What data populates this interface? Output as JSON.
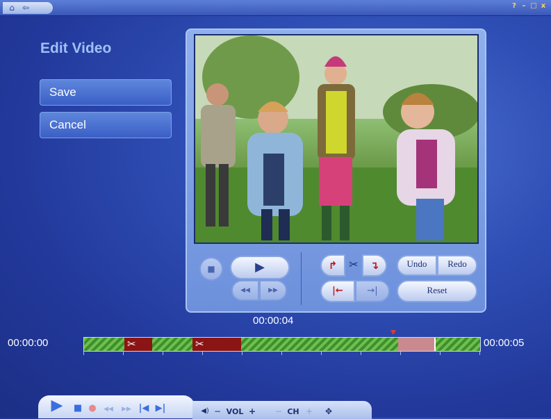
{
  "window": {
    "controls": [
      "?",
      "–",
      "□",
      "x"
    ]
  },
  "nav": {
    "home_icon": "⌂",
    "back_icon": "⇦"
  },
  "page": {
    "title": "Edit Video"
  },
  "actions": {
    "save_label": "Save",
    "cancel_label": "Cancel"
  },
  "editor": {
    "stop_icon": "■",
    "play_icon": "▶",
    "rewind_icon": "◀◀",
    "forward_icon": "▶▶",
    "split_left_icon": "↱",
    "scissors_icon": "✂",
    "split_right_icon": "↴",
    "trim_start_icon": "|←",
    "trim_end_icon": "→|",
    "undo_label": "Undo",
    "redo_label": "Redo",
    "reset_label": "Reset"
  },
  "timeline": {
    "current_time": "00:00:04",
    "start_time": "00:00:00",
    "end_time": "00:00:05",
    "cut_icon": "✂",
    "marker_fraction": 0.78
  },
  "transport": {
    "play_icon": "▶",
    "stop_icon": "■",
    "record_icon": "●",
    "rewind_icon": "◀◀",
    "ffwd_icon": "▶▶",
    "prev_icon": "|◀",
    "next_icon": "▶|",
    "mute_icon": "◀)",
    "vol_minus_icon": "−",
    "vol_label": "VOL",
    "vol_plus_icon": "+",
    "ch_minus_icon": "−",
    "ch_label": "CH",
    "ch_plus_icon": "+",
    "fullscreen_icon": "✥"
  },
  "colors": {
    "background": "#2f4fb6",
    "timeline_green": "#3e8f2e",
    "cut_red": "#8b1414",
    "selection": "#c98a8f"
  }
}
